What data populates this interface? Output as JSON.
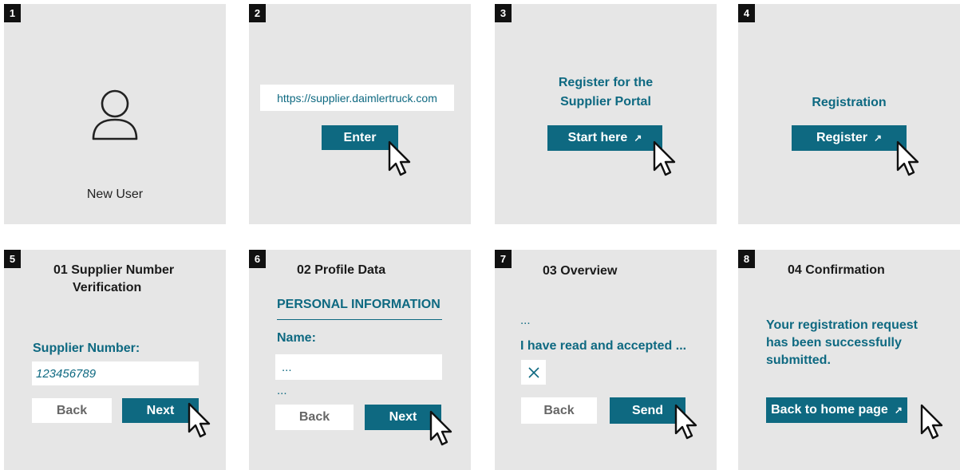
{
  "colors": {
    "accent": "#0e6981",
    "panel_bg": "#e6e6e6",
    "badge_bg": "#111111"
  },
  "steps": [
    {
      "number": "1",
      "label": "New User",
      "icon": "user-icon"
    },
    {
      "number": "2",
      "url": "https://supplier.daimlertruck.com",
      "button": "Enter"
    },
    {
      "number": "3",
      "heading_line1": "Register for the",
      "heading_line2": "Supplier Portal",
      "button": "Start here"
    },
    {
      "number": "4",
      "heading": "Registration",
      "button": "Register"
    },
    {
      "number": "5",
      "title_line1": "01 Supplier Number",
      "title_line2": "Verification",
      "field_label": "Supplier Number:",
      "field_value": "123456789",
      "back": "Back",
      "next": "Next"
    },
    {
      "number": "6",
      "title": "02 Profile Data",
      "section": "PERSONAL INFORMATION",
      "field_label": "Name:",
      "field_value": "...",
      "ellipsis": "...",
      "back": "Back",
      "next": "Next"
    },
    {
      "number": "7",
      "title": "03 Overview",
      "ellipsis": "...",
      "accept_text": "I have read and accepted ...",
      "back": "Back",
      "send": "Send"
    },
    {
      "number": "8",
      "title": "04 Confirmation",
      "message_line1": "Your registration request",
      "message_line2": "has been successfully",
      "message_line3": "submitted.",
      "button": "Back to home page"
    }
  ],
  "icons": {
    "external_link": "arrow-up-right-icon",
    "cursor": "pointer-cursor-icon",
    "checkbox_mark": "x-mark-icon"
  }
}
